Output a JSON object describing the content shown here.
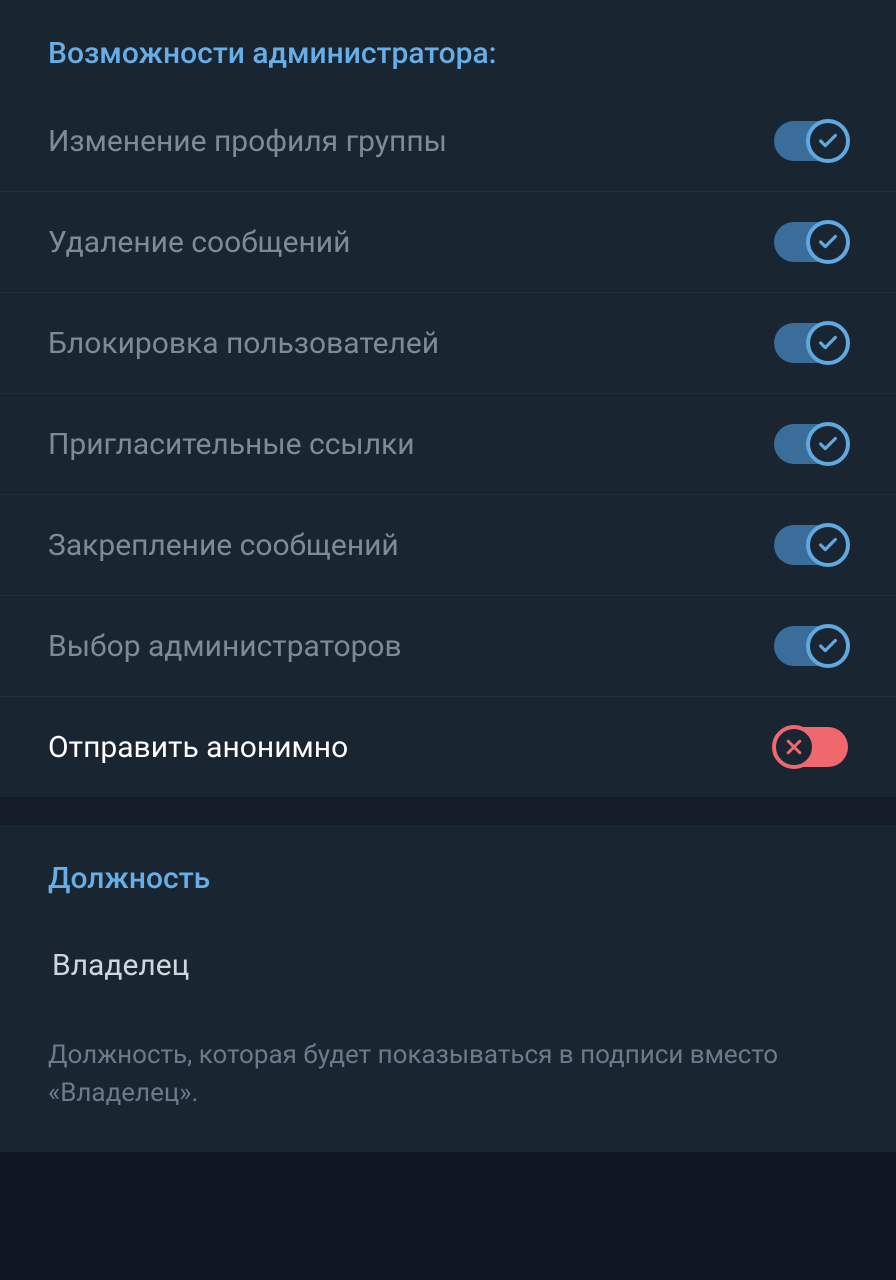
{
  "permissions": {
    "header": "Возможности администратора:",
    "items": [
      {
        "label": "Изменение профиля группы",
        "on": true
      },
      {
        "label": "Удаление сообщений",
        "on": true
      },
      {
        "label": "Блокировка пользователей",
        "on": true
      },
      {
        "label": "Пригласительные ссылки",
        "on": true
      },
      {
        "label": "Закрепление сообщений",
        "on": true
      },
      {
        "label": "Выбор администраторов",
        "on": true
      },
      {
        "label": "Отправить анонимно",
        "on": false,
        "bright": true
      }
    ]
  },
  "titleSection": {
    "header": "Должность",
    "value": "Владелец",
    "helper": "Должность, которая будет показываться в подписи вместо «Владелец»."
  }
}
